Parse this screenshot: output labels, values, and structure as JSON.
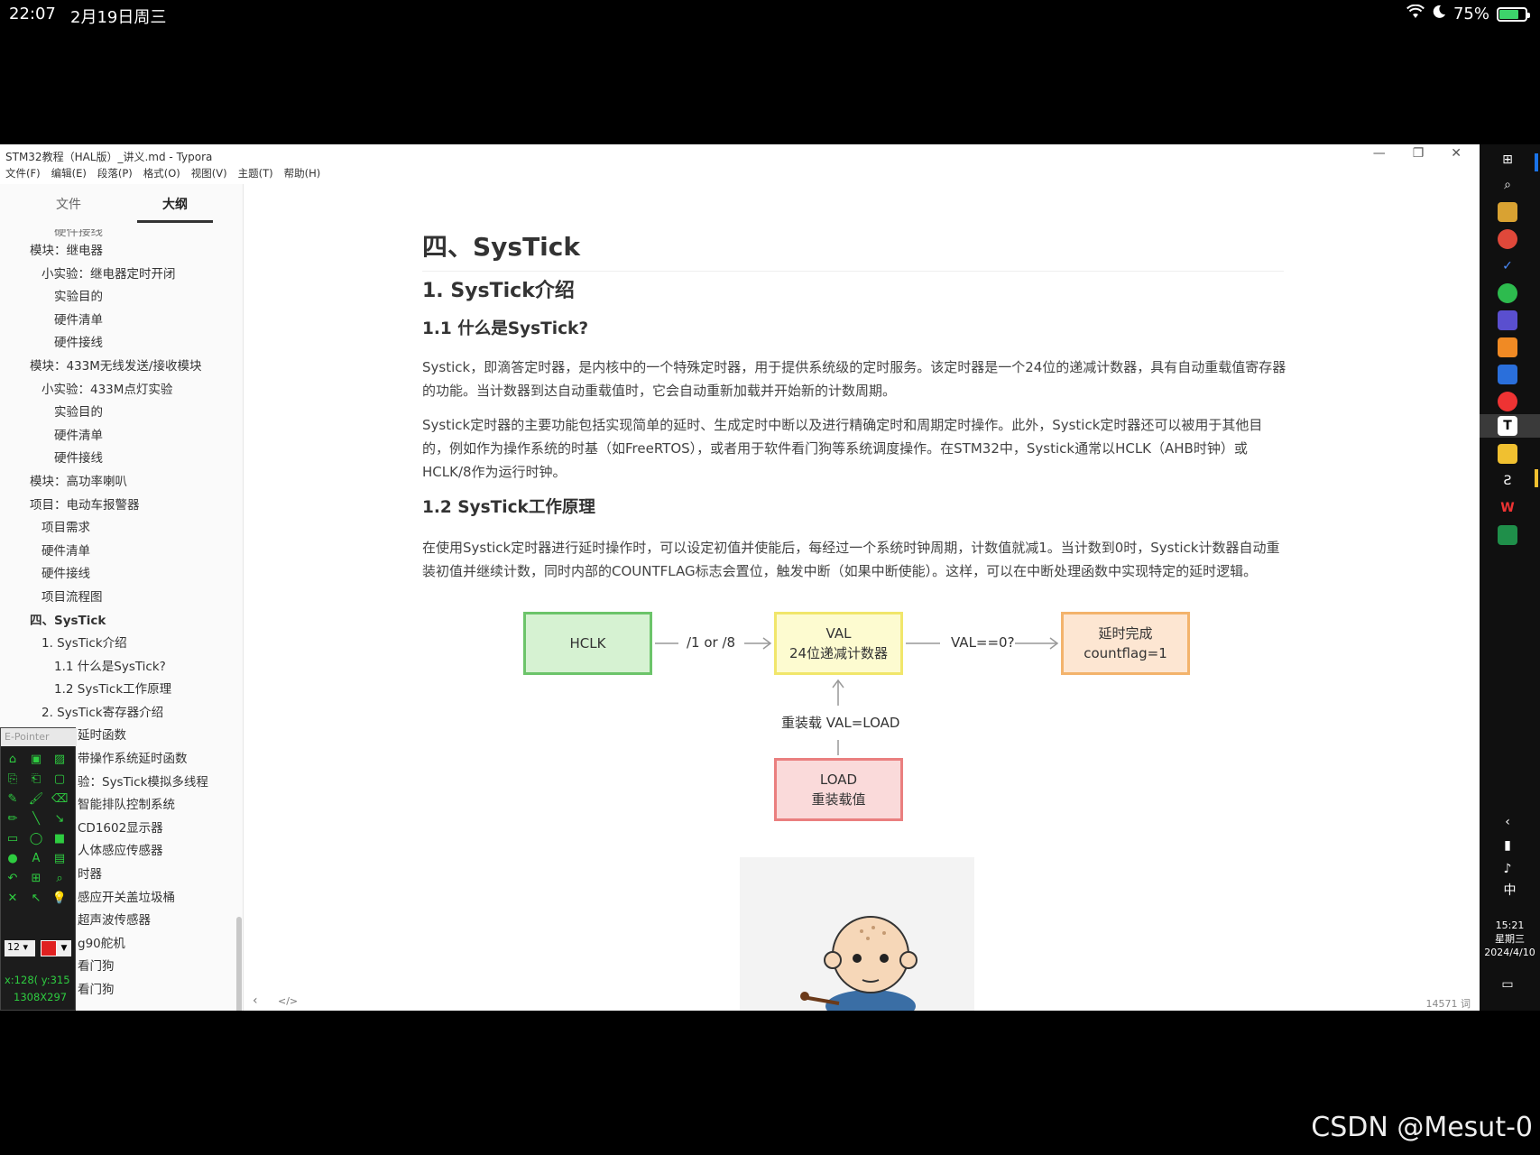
{
  "status_bar": {
    "time": "22:07",
    "date": "2月19日周三",
    "battery": "75%",
    "battery_level": 0.75
  },
  "window": {
    "title": "STM32教程（HAL版）_讲义.md - Typora",
    "menu": [
      "文件(F)",
      "编辑(E)",
      "段落(P)",
      "格式(O)",
      "视图(V)",
      "主题(T)",
      "帮助(H)"
    ]
  },
  "sidebar": {
    "tabs": [
      "文件",
      "大纲"
    ],
    "active_tab": "大纲",
    "outline": [
      {
        "label": "硬件接线",
        "level": 3,
        "clipped": true
      },
      {
        "label": "模块：继电器",
        "level": 1
      },
      {
        "label": "小实验：继电器定时开闭",
        "level": 2
      },
      {
        "label": "实验目的",
        "level": 3
      },
      {
        "label": "硬件清单",
        "level": 3
      },
      {
        "label": "硬件接线",
        "level": 3
      },
      {
        "label": "模块：433M无线发送/接收模块",
        "level": 1
      },
      {
        "label": "小实验：433M点灯实验",
        "level": 2
      },
      {
        "label": "实验目的",
        "level": 3
      },
      {
        "label": "硬件清单",
        "level": 3
      },
      {
        "label": "硬件接线",
        "level": 3
      },
      {
        "label": "模块：高功率喇叭",
        "level": 1
      },
      {
        "label": "项目：电动车报警器",
        "level": 1
      },
      {
        "label": "项目需求",
        "level": 2
      },
      {
        "label": "硬件清单",
        "level": 2
      },
      {
        "label": "硬件接线",
        "level": 2
      },
      {
        "label": "项目流程图",
        "level": 2
      },
      {
        "label": "四、SysTick",
        "level": 1,
        "bold": true
      },
      {
        "label": "1. SysTick介绍",
        "level": 2
      },
      {
        "label": "1.1 什么是SysTick?",
        "level": 3
      },
      {
        "label": "1.2 SysTick工作原理",
        "level": 3
      },
      {
        "label": "2. SysTick寄存器介绍",
        "level": 2
      },
      {
        "label": "延时函数",
        "level": 4
      },
      {
        "label": "带操作系统延时函数",
        "level": 4
      },
      {
        "label": "验：SysTick模拟多线程",
        "level": 4
      },
      {
        "label": "智能排队控制系统",
        "level": 4
      },
      {
        "label": "CD1602显示器",
        "level": 4
      },
      {
        "label": "人体感应传感器",
        "level": 4
      },
      {
        "label": "时器",
        "level": 4
      },
      {
        "label": "感应开关盖垃圾桶",
        "level": 4
      },
      {
        "label": "超声波传感器",
        "level": 4
      },
      {
        "label": "g90舵机",
        "level": 4
      },
      {
        "label": "看门狗",
        "level": 4
      },
      {
        "label": "看门狗",
        "level": 4
      }
    ]
  },
  "epointer": {
    "title": "E-Pointer",
    "size": "12",
    "coords": "x:128( y:315",
    "dims": "1308X297",
    "tools": [
      "open-icon",
      "save-icon",
      "image-icon",
      "copy-icon",
      "paste-icon",
      "rect-select-icon",
      "pen-icon",
      "brush-icon",
      "eraser-icon",
      "pencil-icon",
      "line-icon",
      "arrow-icon",
      "rectangle-icon",
      "ellipse-icon",
      "filled-rect-icon",
      "filled-ellipse-icon",
      "text-icon",
      "highlight-icon",
      "undo-icon",
      "grid-icon",
      "zoom-icon",
      "close-icon",
      "cursor-icon",
      "bulb-icon"
    ]
  },
  "doc": {
    "h1": "四、SysTick",
    "h2": "1. SysTick介绍",
    "h3_1": "1.1 什么是SysTick?",
    "p1": "Systick，即滴答定时器，是内核中的一个特殊定时器，用于提供系统级的定时服务。该定时器是一个24位的递减计数器，具有自动重载值寄存器的功能。当计数器到达自动重载值时，它会自动重新加载并开始新的计数周期。",
    "p2": "Systick定时器的主要功能包括实现简单的延时、生成定时中断以及进行精确定时和周期定时操作。此外，Systick定时器还可以被用于其他目的，例如作为操作系统的时基（如FreeRTOS），或者用于软件看门狗等系统调度操作。在STM32中，Systick通常以HCLK（AHB时钟）或HCLK/8作为运行时钟。",
    "h3_2": "1.2 SysTick工作原理",
    "p3": "在使用Systick定时器进行延时操作时，可以设定初值并使能后，每经过一个系统时钟周期，计数值就减1。当计数到0时，Systick计数器自动重装初值并继续计数，同时内部的COUNTFLAG标志会置位，触发中断（如果中断使能）。这样，可以在中断处理函数中实现特定的延时逻辑。",
    "word_count": "14571 词"
  },
  "diagram": {
    "hclk": "HCLK",
    "divider": "/1 or /8",
    "val_line1": "VAL",
    "val_line2": "24位递减计数器",
    "check": "VAL==0?",
    "done_line1": "延时完成",
    "done_line2": "countflag=1",
    "reload": "重装载 VAL=LOAD",
    "load_line1": "LOAD",
    "load_line2": "重装载值"
  },
  "taskbar": {
    "clock_time": "15:21",
    "clock_day": "星期三",
    "clock_date": "2024/4/10",
    "ime": "中"
  },
  "watermark": "CSDN @Mesut-0"
}
